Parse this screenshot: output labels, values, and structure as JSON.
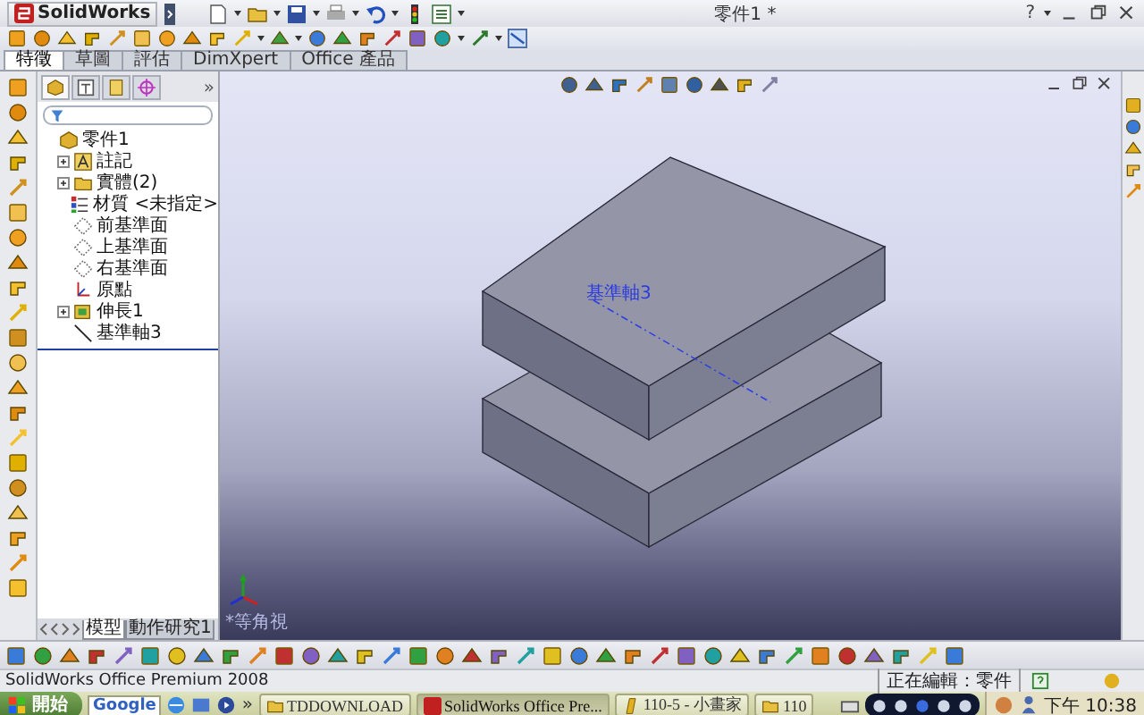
{
  "app": {
    "logo": "SolidWorks"
  },
  "window": {
    "title": "零件1 *",
    "help": "?"
  },
  "tabs": [
    {
      "label": "特徵",
      "selected": true
    },
    {
      "label": "草圖",
      "selected": false
    },
    {
      "label": "評估",
      "selected": false
    },
    {
      "label": "DimXpert",
      "selected": false
    },
    {
      "label": "Office 產品",
      "selected": false
    }
  ],
  "feature_manager": {
    "more": "»",
    "tree": [
      {
        "label": "零件1",
        "kind": "part",
        "children": [
          {
            "label": "註記",
            "kind": "annotations",
            "expanded": false
          },
          {
            "label": "實體(2)",
            "kind": "bodies",
            "expanded": false
          },
          {
            "label": "材質 <未指定>",
            "kind": "material"
          },
          {
            "label": "前基準面",
            "kind": "plane"
          },
          {
            "label": "上基準面",
            "kind": "plane"
          },
          {
            "label": "右基準面",
            "kind": "plane"
          },
          {
            "label": "原點",
            "kind": "origin"
          },
          {
            "label": "伸長1",
            "kind": "extrude",
            "expanded": false
          },
          {
            "label": "基準軸3",
            "kind": "axis"
          }
        ]
      }
    ],
    "bottom_tabs": [
      {
        "label": "模型",
        "selected": true
      },
      {
        "label": "動作研究1",
        "selected": false
      }
    ]
  },
  "viewport": {
    "axis_label": "基準軸3",
    "view_label": "*等角視"
  },
  "status_bar": {
    "product": "SolidWorks Office Premium 2008",
    "mode": "正在編輯：零件"
  },
  "taskbar": {
    "start": "開始",
    "search": "Google",
    "more": "»",
    "buttons": [
      {
        "label": "TDDOWNLOAD",
        "kind": "folder",
        "selected": false
      },
      {
        "label": "SolidWorks Office Pre...",
        "kind": "app",
        "selected": true
      },
      {
        "label": "110-5 - 小畫家",
        "kind": "paint",
        "selected": false
      },
      {
        "label": "110",
        "kind": "folder",
        "selected": false
      }
    ],
    "clock": "下午 10:38"
  }
}
